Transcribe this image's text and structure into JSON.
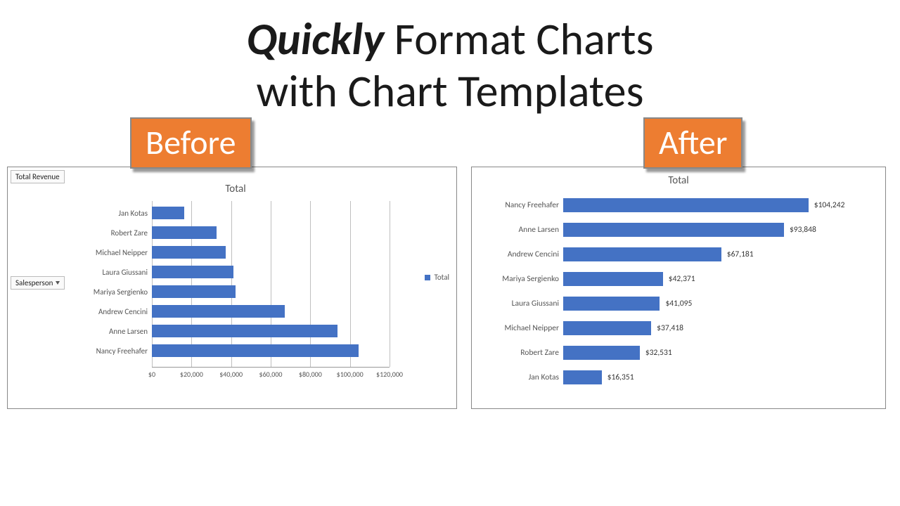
{
  "headline": {
    "emph": "Quickly",
    "rest1": " Format Charts",
    "rest2": "with Chart Templates"
  },
  "before": {
    "tag": "Before",
    "field_revenue": "Total Revenue",
    "field_salesperson": "Salesperson"
  },
  "after": {
    "tag": "After"
  },
  "legend_label": "Total",
  "chart_data": [
    {
      "id": "before",
      "type": "bar",
      "orientation": "horizontal",
      "title": "Total",
      "xlabel": "",
      "ylabel": "",
      "xlim": [
        0,
        120000
      ],
      "x_ticks": [
        0,
        20000,
        40000,
        60000,
        80000,
        100000,
        120000
      ],
      "x_tick_labels": [
        "$0",
        "$20,000",
        "$40,000",
        "$60,000",
        "$80,000",
        "$100,000",
        "$120,000"
      ],
      "categories": [
        "Jan Kotas",
        "Robert Zare",
        "Michael Neipper",
        "Laura Giussani",
        "Mariya Sergienko",
        "Andrew Cencini",
        "Anne Larsen",
        "Nancy Freehafer"
      ],
      "values": [
        16351,
        32531,
        37418,
        41095,
        42371,
        67181,
        93848,
        104242
      ],
      "legend": "Total",
      "gridlines": true
    },
    {
      "id": "after",
      "type": "bar",
      "orientation": "horizontal",
      "title": "Total",
      "xlabel": "",
      "ylabel": "",
      "xlim": [
        0,
        110000
      ],
      "categories": [
        "Nancy Freehafer",
        "Anne Larsen",
        "Andrew Cencini",
        "Mariya Sergienko",
        "Laura Giussani",
        "Michael Neipper",
        "Robert Zare",
        "Jan Kotas"
      ],
      "values": [
        104242,
        93848,
        67181,
        42371,
        41095,
        37418,
        32531,
        16351
      ],
      "value_labels": [
        "$104,242",
        "$93,848",
        "$67,181",
        "$42,371",
        "$41,095",
        "$37,418",
        "$32,531",
        "$16,351"
      ],
      "gridlines": false
    }
  ]
}
